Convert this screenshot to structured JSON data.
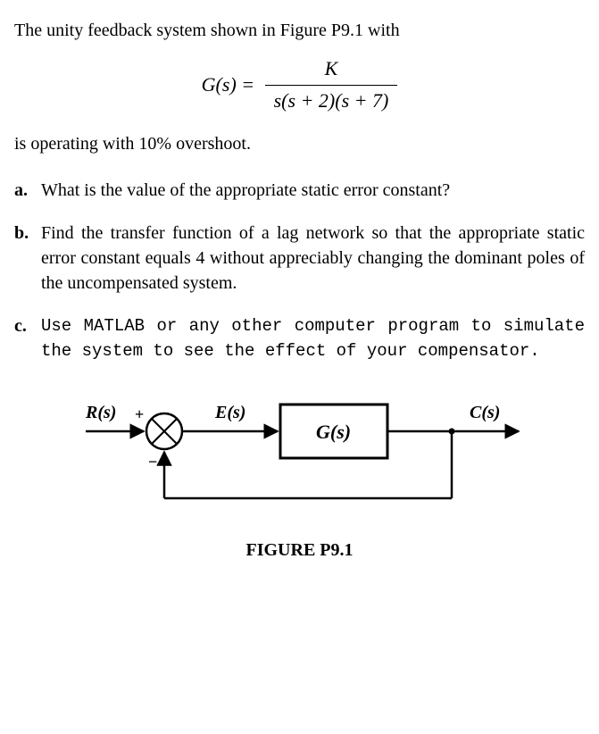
{
  "intro_before": "The unity feedback system shown in Figure P9.1 with",
  "equation": {
    "lhs": "G(s) = ",
    "numerator": "K",
    "denominator": "s(s + 2)(s + 7)"
  },
  "intro_after": "is operating with 10% overshoot.",
  "parts": [
    {
      "marker": "a.",
      "text": "What is the value of the appropriate static error constant?",
      "mono": false
    },
    {
      "marker": "b.",
      "text": "Find the transfer function of a lag network so that the appropriate static error constant equals 4 without appreciably changing the dominant poles of the uncompensated system.",
      "mono": false
    },
    {
      "marker": "c.",
      "text": "Use MATLAB or any other computer program to simulate the system to see the effect of your compensator.",
      "mono": true
    }
  ],
  "diagram": {
    "r_label": "R(s)",
    "plus": "+",
    "minus": "−",
    "e_label": "E(s)",
    "g_label": "G(s)",
    "c_label": "C(s)"
  },
  "figure_caption": "FIGURE P9.1"
}
